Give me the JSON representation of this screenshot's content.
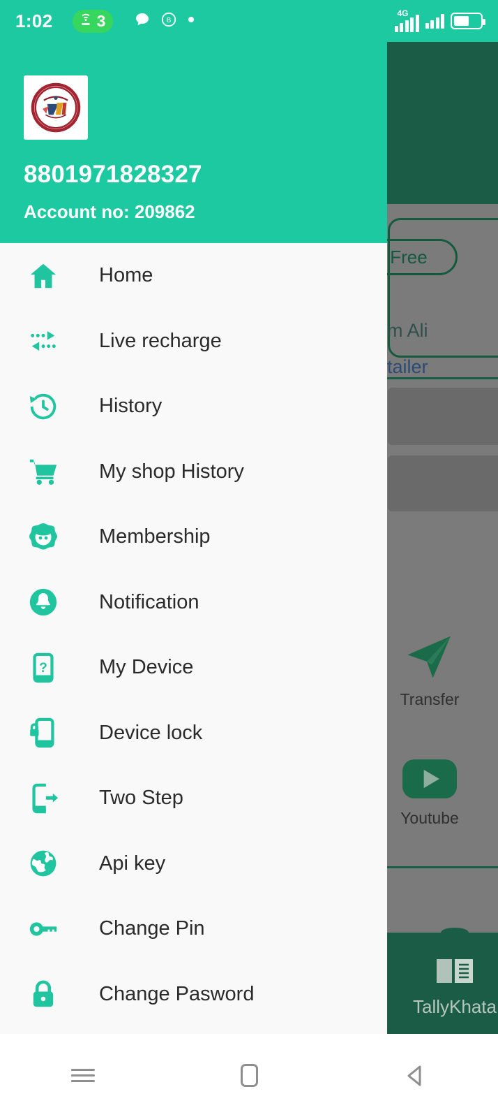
{
  "status_bar": {
    "time": "1:02",
    "hotspot_icon": "hotspot-icon",
    "hotspot_count": "3",
    "chat_icon": "chat-bubble-icon",
    "b_icon": "bkash-circle-icon",
    "dot_icon": "dot-icon",
    "network_type": "4G",
    "signal_icon": "signal-bars-icon",
    "signal2_icon": "signal-bars-secondary-icon",
    "battery_icon": "battery-icon",
    "colors": {
      "bar_bg": "#1dc9a0",
      "hotspot_pill": "#36d65f"
    }
  },
  "drawer": {
    "header": {
      "avatar_icon": "profile-seal-logo",
      "phone_number": "8801971828327",
      "account_label": "Account no: 209862",
      "bg_color": "#1dc9a0"
    },
    "items": [
      {
        "label": "Home",
        "icon": "home-icon"
      },
      {
        "label": "Live recharge",
        "icon": "live-recharge-arrows-icon"
      },
      {
        "label": "History",
        "icon": "history-clock-icon"
      },
      {
        "label": "My shop History",
        "icon": "shopping-cart-icon"
      },
      {
        "label": "Membership",
        "icon": "membership-face-icon"
      },
      {
        "label": "Notification",
        "icon": "bell-icon"
      },
      {
        "label": "My Device",
        "icon": "device-question-icon"
      },
      {
        "label": "Device lock",
        "icon": "device-lock-icon"
      },
      {
        "label": "Two Step",
        "icon": "device-arrow-out-icon"
      },
      {
        "label": "Api key",
        "icon": "globe-icon"
      },
      {
        "label": "Change Pin",
        "icon": "key-icon"
      },
      {
        "label": "Change Pasword",
        "icon": "padlock-icon"
      }
    ],
    "accent_color": "#20c5a0"
  },
  "background_app": {
    "free_badge": "Free",
    "user_name": "am Ali",
    "user_role": "etailer",
    "tiles": [
      {
        "label": "Transfer",
        "icon": "paper-plane-icon"
      },
      {
        "label": "Youtube",
        "icon": "youtube-play-icon"
      }
    ],
    "bottom_bar": {
      "label": "TallyKhata",
      "icon": "book-icon"
    },
    "colors": {
      "scrim": "#7b7b7b",
      "dark_green": "#1a5c45"
    }
  },
  "nav_bar": {
    "recents_icon": "recents-icon",
    "home_icon": "home-square-icon",
    "back_icon": "back-triangle-icon"
  }
}
